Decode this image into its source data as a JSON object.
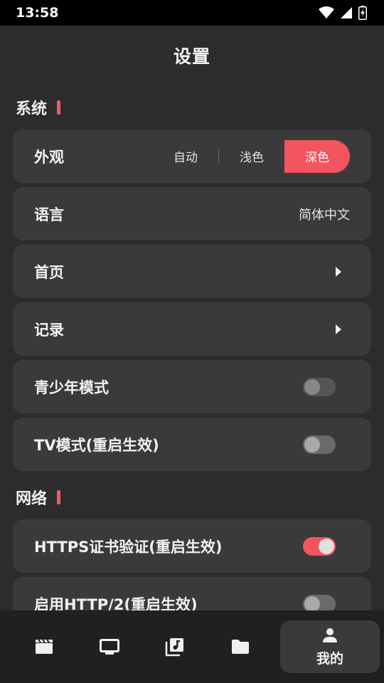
{
  "status_bar": {
    "time": "13:58",
    "icons": [
      "wifi-icon",
      "cell-signal-icon",
      "battery-charging-icon"
    ]
  },
  "header": {
    "title": "设置"
  },
  "sections": {
    "system": {
      "label": "系统",
      "appearance": {
        "label": "外观",
        "options": [
          "自动",
          "浅色",
          "深色"
        ],
        "selected": "深色"
      },
      "language": {
        "label": "语言",
        "value": "简体中文"
      },
      "home": {
        "label": "首页"
      },
      "history": {
        "label": "记录"
      },
      "teen_mode": {
        "label": "青少年模式",
        "enabled": false
      },
      "tv_mode": {
        "label": "TV模式(重启生效)",
        "enabled": false
      }
    },
    "network": {
      "label": "网络",
      "https_verify": {
        "label": "HTTPS证书验证(重启生效)",
        "enabled": true
      },
      "http2": {
        "label": "启用HTTP/2(重启生效)",
        "enabled": false
      }
    }
  },
  "bottom_nav": {
    "items": [
      {
        "icon": "clapperboard-icon",
        "label": ""
      },
      {
        "icon": "tv-icon",
        "label": ""
      },
      {
        "icon": "music-library-icon",
        "label": ""
      },
      {
        "icon": "folder-icon",
        "label": ""
      },
      {
        "icon": "person-icon",
        "label": "我的",
        "active": true
      }
    ]
  },
  "colors": {
    "accent": "#f2555d",
    "background": "#2c2c2e",
    "card": "#3a3a3d"
  }
}
